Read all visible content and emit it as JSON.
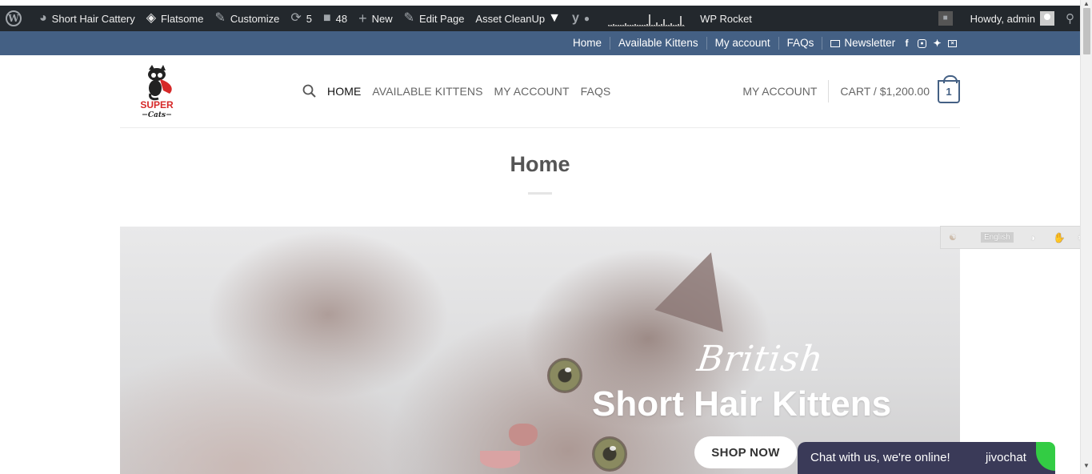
{
  "adminbar": {
    "site_name": "Short Hair Cattery",
    "theme": "Flatsome",
    "customize": "Customize",
    "updates": "5",
    "comments": "48",
    "new": "New",
    "edit_page": "Edit Page",
    "asset_cleanup": "Asset CleanUp",
    "wp_rocket": "WP Rocket",
    "greeting": "Howdy, admin"
  },
  "topnav": {
    "links": [
      "Home",
      "Available Kittens",
      "My account",
      "FAQs"
    ],
    "newsletter": "Newsletter",
    "social": [
      "facebook-icon",
      "instagram-icon",
      "twitter-icon",
      "email-icon"
    ]
  },
  "header": {
    "logo_text_top": "SUPER",
    "logo_text_bottom": "Cats",
    "menu": [
      "HOME",
      "AVAILABLE KITTENS",
      "MY ACCOUNT",
      "FAQS"
    ],
    "account": "MY ACCOUNT",
    "cart_label": "CART /",
    "cart_total": "$1,200.00",
    "cart_count": "1"
  },
  "page": {
    "title": "Home"
  },
  "hero": {
    "script": "British",
    "title": "Short Hair Kittens",
    "button": "SHOP NOW"
  },
  "lang_widget": {
    "language": "English"
  },
  "chat": {
    "text": "Chat with us, we're online!",
    "brand": "jivochat"
  },
  "colors": {
    "adminbar": "#23282d",
    "primary": "#446084",
    "chat": "#3a3a58",
    "chat_accent": "#33cc44"
  }
}
